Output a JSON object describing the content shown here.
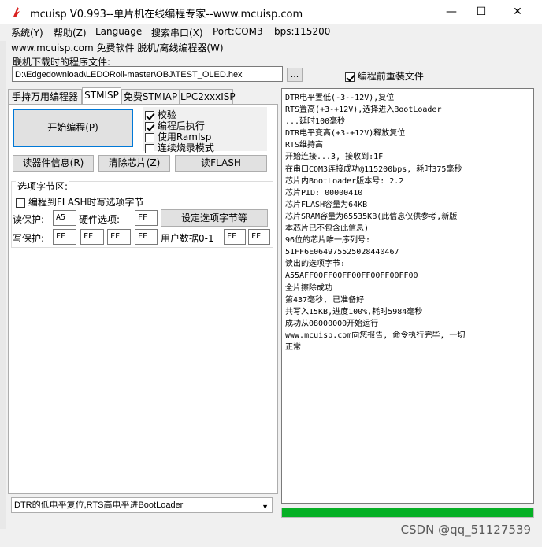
{
  "window": {
    "title": "mcuisp V0.993--单片机在线编程专家--www.mcuisp.com",
    "minimize": "—",
    "maximize": "☐",
    "close": "✕"
  },
  "menu": [
    "系统(Y)",
    "帮助(Z)",
    "Language",
    "搜索串口(X)",
    "Port:COM3",
    "bps:115200"
  ],
  "subline": "www.mcuisp.com 免费软件 脱机/离线编程器(W)",
  "file": {
    "label": "联机下载时的程序文件:",
    "path": "D:\\Edgedownload\\LEDORoll-master\\OBJ\\TEST_OLED.hex",
    "browse": "...",
    "reload_label": "编程前重装文件",
    "reload_checked": true
  },
  "tabs": [
    "手持万用编程器",
    "STMISP",
    "免费STMIAP",
    "LPC2xxxISP"
  ],
  "active_tab": "STMISP",
  "panel": {
    "start_button": "开始编程(P)",
    "options": [
      {
        "label": "校验",
        "checked": true
      },
      {
        "label": "编程后执行",
        "checked": true
      },
      {
        "label": "使用RamIsp",
        "checked": false
      },
      {
        "label": "连续烧录模式",
        "checked": false
      }
    ],
    "btn_read_info": "读器件信息(R)",
    "btn_erase": "清除芯片(Z)",
    "btn_read_flash": "读FLASH",
    "optbyte": {
      "title": "选项字节区:",
      "write_flash_label": "编程到FLASH时写选项字节",
      "write_flash_checked": false,
      "read_protect_label": "读保护:",
      "read_protect_value": "A5",
      "hw_option_label": "硬件选项:",
      "hw_option_value": "FF",
      "set_button": "设定选项字节等",
      "write_protect_label": "写保护:",
      "write_protect_values": [
        "FF",
        "FF",
        "FF",
        "FF"
      ],
      "user_data_label": "用户数据0-1",
      "user_data_values": [
        "FF",
        "FF"
      ]
    },
    "mode_select": "DTR的低电平复位,RTS高电平进BootLoader"
  },
  "log": [
    "DTR电平置低(-3--12V),复位",
    "RTS置高(+3-+12V),选择进入BootLoader",
    "...延时100毫秒",
    "DTR电平变高(+3-+12V)释放复位",
    "RTS维持高",
    "开始连接...3, 接收到:1F",
    "在串口COM3连接成功@115200bps, 耗时375毫秒",
    "芯片内BootLoader版本号: 2.2",
    "芯片PID: 00000410",
    "芯片FLASH容量为64KB",
    "芯片SRAM容量为65535KB(此信息仅供参考,新版",
    "本芯片已不包含此信息)",
    "96位的芯片唯一序列号:",
    "51FF6E064975525028440467",
    "读出的选项字节:",
    "A55AFF00FF00FF00FF00FF00FF00",
    "全片擦除成功",
    "第437毫秒, 已准备好",
    "共写入15KB,进度100%,耗时5984毫秒",
    "成功从08000000开始运行",
    "www.mcuisp.com向您报告, 命令执行完毕, 一切",
    "正常"
  ],
  "progress": 1.0,
  "colors": {
    "progress": "#06b025",
    "focus": "#0078d7",
    "app_icon": "#d8201f"
  },
  "watermark": "CSDN @qq_51127539"
}
